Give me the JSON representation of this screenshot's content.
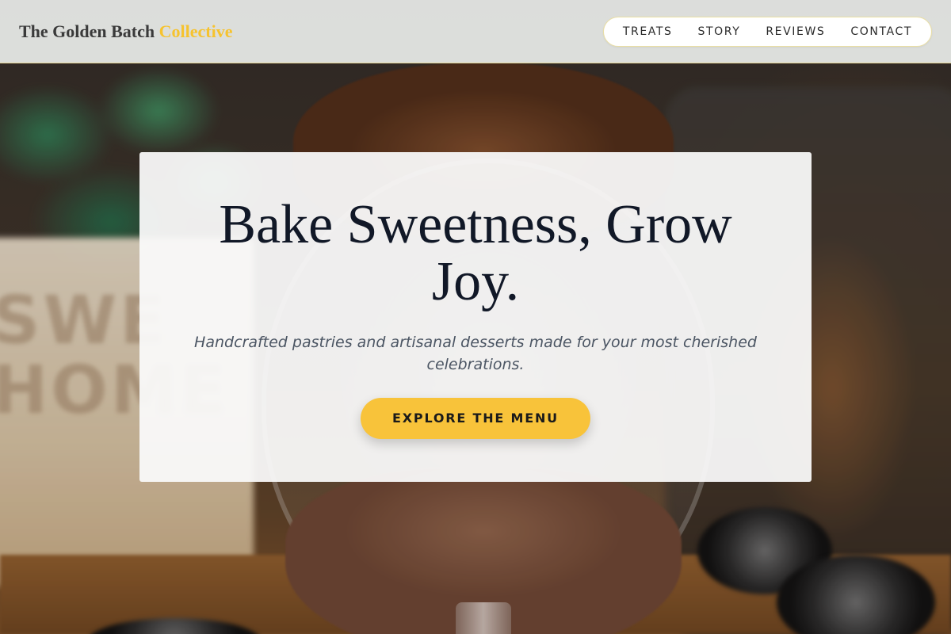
{
  "header": {
    "brand_main": "The Golden Batch",
    "brand_accent": "Collective"
  },
  "nav": {
    "items": [
      {
        "label": "TREATS"
      },
      {
        "label": "STORY"
      },
      {
        "label": "REVIEWS"
      },
      {
        "label": "CONTACT"
      }
    ]
  },
  "hero": {
    "title": "Bake Sweetness, Grow Joy.",
    "subtitle": "Handcrafted pastries and artisanal desserts made for your most cherished celebrations.",
    "cta_label": "EXPLORE THE MENU"
  },
  "theme": {
    "accent": "#f8c33a",
    "title_color": "#111827",
    "text_color": "#4b5563"
  }
}
